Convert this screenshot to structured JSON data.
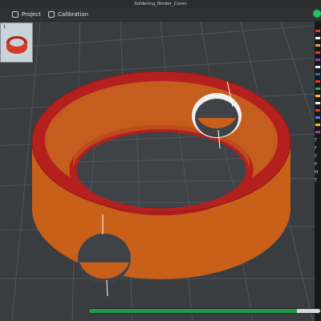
{
  "window": {
    "title": "Soldering_Binder_Cover"
  },
  "tabs": [
    {
      "label": "Project",
      "icon": "project-icon"
    },
    {
      "label": "Calibration",
      "icon": "calibration-icon"
    }
  ],
  "status": {
    "sync_indicator_color": "#23c45a"
  },
  "plate_thumbnail": {
    "number": "1"
  },
  "right_panel": {
    "color_swatches": [
      "#e03a2e",
      "#f2f2f2",
      "#e9a13a",
      "#e03a2e",
      "#8e44ad",
      "#f2f2f2",
      "#1e6fb8",
      "#e03a2e",
      "#2bb34a",
      "#f0c419",
      "#f2f2f2",
      "#e03a2e",
      "#4f7fd1",
      "#f0c419",
      "#8e44ad"
    ],
    "labels": [
      "T",
      "F",
      "C",
      "P",
      "M",
      "T"
    ]
  },
  "model": {
    "name": "soldering-binder-cover",
    "outer_color": "#c9601a",
    "top_color": "#b3201e"
  },
  "progress": {
    "fraction": 0.9,
    "color": "#1f9a4a"
  }
}
